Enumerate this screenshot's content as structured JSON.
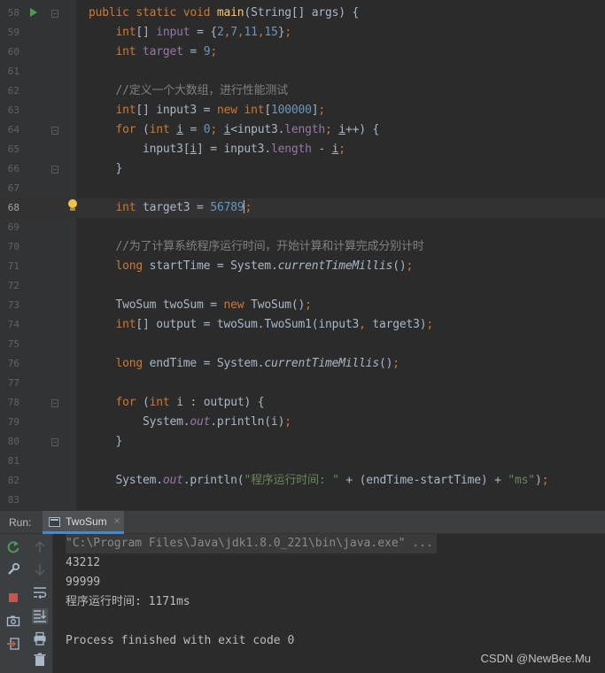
{
  "editor": {
    "lines": [
      {
        "num": "58",
        "tokens": [
          [
            "kw",
            "public static void "
          ],
          [
            "fn",
            "main"
          ],
          [
            "p",
            "(String[] args) {"
          ]
        ]
      },
      {
        "num": "59",
        "tokens": [
          [
            "p",
            "    "
          ],
          [
            "kw",
            "int"
          ],
          [
            "p",
            "[] "
          ],
          [
            "fld",
            "input"
          ],
          [
            "p",
            " = {"
          ],
          [
            "num",
            "2"
          ],
          [
            "kw",
            ","
          ],
          [
            "num",
            "7"
          ],
          [
            "kw",
            ","
          ],
          [
            "num",
            "11"
          ],
          [
            "kw",
            ","
          ],
          [
            "num",
            "15"
          ],
          [
            "p",
            "}"
          ],
          [
            "kw",
            ";"
          ]
        ]
      },
      {
        "num": "60",
        "tokens": [
          [
            "p",
            "    "
          ],
          [
            "kw",
            "int "
          ],
          [
            "fld",
            "target"
          ],
          [
            "p",
            " = "
          ],
          [
            "num",
            "9"
          ],
          [
            "kw",
            ";"
          ]
        ]
      },
      {
        "num": "61",
        "tokens": []
      },
      {
        "num": "62",
        "tokens": [
          [
            "p",
            "    "
          ],
          [
            "cmt",
            "//定义一个大数组，进行性能测试"
          ]
        ]
      },
      {
        "num": "63",
        "tokens": [
          [
            "p",
            "    "
          ],
          [
            "kw",
            "int"
          ],
          [
            "p",
            "[] input3 = "
          ],
          [
            "kw",
            "new int"
          ],
          [
            "p",
            "["
          ],
          [
            "num",
            "100000"
          ],
          [
            "p",
            "]"
          ],
          [
            "kw",
            ";"
          ]
        ]
      },
      {
        "num": "64",
        "tokens": [
          [
            "p",
            "    "
          ],
          [
            "kw",
            "for "
          ],
          [
            "p",
            "("
          ],
          [
            "kw",
            "int "
          ],
          [
            "ul",
            "i"
          ],
          [
            "p",
            " = "
          ],
          [
            "num",
            "0"
          ],
          [
            "kw",
            "; "
          ],
          [
            "ul",
            "i"
          ],
          [
            "p",
            "<input3."
          ],
          [
            "fld",
            "length"
          ],
          [
            "kw",
            "; "
          ],
          [
            "ul",
            "i"
          ],
          [
            "p",
            "++) {"
          ]
        ]
      },
      {
        "num": "65",
        "tokens": [
          [
            "p",
            "        input3["
          ],
          [
            "ul",
            "i"
          ],
          [
            "p",
            "] = input3."
          ],
          [
            "fld",
            "length"
          ],
          [
            "p",
            " - "
          ],
          [
            "ul",
            "i"
          ],
          [
            "kw",
            ";"
          ]
        ]
      },
      {
        "num": "66",
        "tokens": [
          [
            "p",
            "    }"
          ]
        ]
      },
      {
        "num": "67",
        "tokens": []
      },
      {
        "num": "68",
        "tokens": [
          [
            "p",
            "    "
          ],
          [
            "kw",
            "int "
          ],
          [
            "p",
            "target3 = "
          ],
          [
            "num",
            "56789"
          ],
          [
            "caret",
            ""
          ],
          [
            "kw",
            ";"
          ]
        ]
      },
      {
        "num": "69",
        "tokens": []
      },
      {
        "num": "70",
        "tokens": [
          [
            "p",
            "    "
          ],
          [
            "cmt",
            "//为了计算系统程序运行时间，开始计算和计算完成分别计时"
          ]
        ]
      },
      {
        "num": "71",
        "tokens": [
          [
            "p",
            "    "
          ],
          [
            "kw",
            "long "
          ],
          [
            "p",
            "startTime = System."
          ],
          [
            "ital",
            "currentTimeMillis"
          ],
          [
            "p",
            "()"
          ],
          [
            "kw",
            ";"
          ]
        ]
      },
      {
        "num": "72",
        "tokens": []
      },
      {
        "num": "73",
        "tokens": [
          [
            "p",
            "    TwoSum twoSum = "
          ],
          [
            "kw",
            "new "
          ],
          [
            "p",
            "TwoSum()"
          ],
          [
            "kw",
            ";"
          ]
        ]
      },
      {
        "num": "74",
        "tokens": [
          [
            "p",
            "    "
          ],
          [
            "kw",
            "int"
          ],
          [
            "p",
            "[] output = twoSum.TwoSum1(input3"
          ],
          [
            "kw",
            ", "
          ],
          [
            "p",
            "target3)"
          ],
          [
            "kw",
            ";"
          ]
        ]
      },
      {
        "num": "75",
        "tokens": []
      },
      {
        "num": "76",
        "tokens": [
          [
            "p",
            "    "
          ],
          [
            "kw",
            "long "
          ],
          [
            "p",
            "endTime = System."
          ],
          [
            "ital",
            "currentTimeMillis"
          ],
          [
            "p",
            "()"
          ],
          [
            "kw",
            ";"
          ]
        ]
      },
      {
        "num": "77",
        "tokens": []
      },
      {
        "num": "78",
        "tokens": [
          [
            "p",
            "    "
          ],
          [
            "kw",
            "for "
          ],
          [
            "p",
            "("
          ],
          [
            "kw",
            "int "
          ],
          [
            "p",
            "i : output) {"
          ]
        ]
      },
      {
        "num": "79",
        "tokens": [
          [
            "p",
            "        System."
          ],
          [
            "fldi",
            "out"
          ],
          [
            "p",
            ".println(i)"
          ],
          [
            "kw",
            ";"
          ]
        ]
      },
      {
        "num": "80",
        "tokens": [
          [
            "p",
            "    }"
          ]
        ]
      },
      {
        "num": "81",
        "tokens": []
      },
      {
        "num": "82",
        "tokens": [
          [
            "p",
            "    System."
          ],
          [
            "fldi",
            "out"
          ],
          [
            "p",
            ".println("
          ],
          [
            "str",
            "\"程序运行时间: \""
          ],
          [
            "p",
            " + (endTime-startTime) + "
          ],
          [
            "str",
            "\"ms\""
          ],
          [
            "p",
            ")"
          ],
          [
            "kw",
            ";"
          ]
        ]
      },
      {
        "num": "83",
        "tokens": []
      }
    ],
    "current_line": "68"
  },
  "run_panel": {
    "label": "Run:",
    "tab_label": "TwoSum",
    "tab_close": "×",
    "console_lines": [
      "\"C:\\Program Files\\Java\\jdk1.8.0_221\\bin\\java.exe\" ...",
      "43212",
      "99999",
      "程序运行时间: 1171ms",
      "",
      "Process finished with exit code 0"
    ]
  },
  "watermark": "CSDN @NewBee.Mu",
  "colors": {
    "keyword": "#cc7832",
    "number": "#6897bb",
    "string": "#6a8759",
    "field": "#9876aa",
    "comment": "#808080",
    "method": "#ffc66d",
    "run_icon": "#499c54",
    "stop_icon": "#c75450"
  },
  "icons": [
    "rerun-icon",
    "up-arrow-icon",
    "wrench-icon",
    "down-arrow-icon",
    "stop-icon",
    "soft-wrap-icon",
    "camera-icon",
    "scroll-to-end-icon",
    "exit-icon",
    "print-icon",
    "trash-icon"
  ]
}
